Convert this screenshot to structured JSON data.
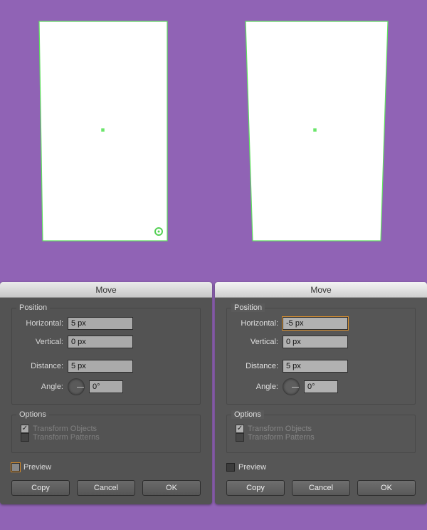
{
  "title": "Move",
  "group_position": "Position",
  "group_options": "Options",
  "labels": {
    "horizontal": "Horizontal:",
    "vertical": "Vertical:",
    "distance": "Distance:",
    "angle": "Angle:"
  },
  "options": {
    "transform_objects": "Transform Objects",
    "transform_patterns": "Transform Patterns"
  },
  "preview": "Preview",
  "buttons": {
    "copy": "Copy",
    "cancel": "Cancel",
    "ok": "OK"
  },
  "left": {
    "horizontal": "5 px",
    "vertical": "0 px",
    "distance": "5 px",
    "angle": "0°"
  },
  "right": {
    "horizontal": "-5 px",
    "vertical": "0 px",
    "distance": "5 px",
    "angle": "0°"
  }
}
